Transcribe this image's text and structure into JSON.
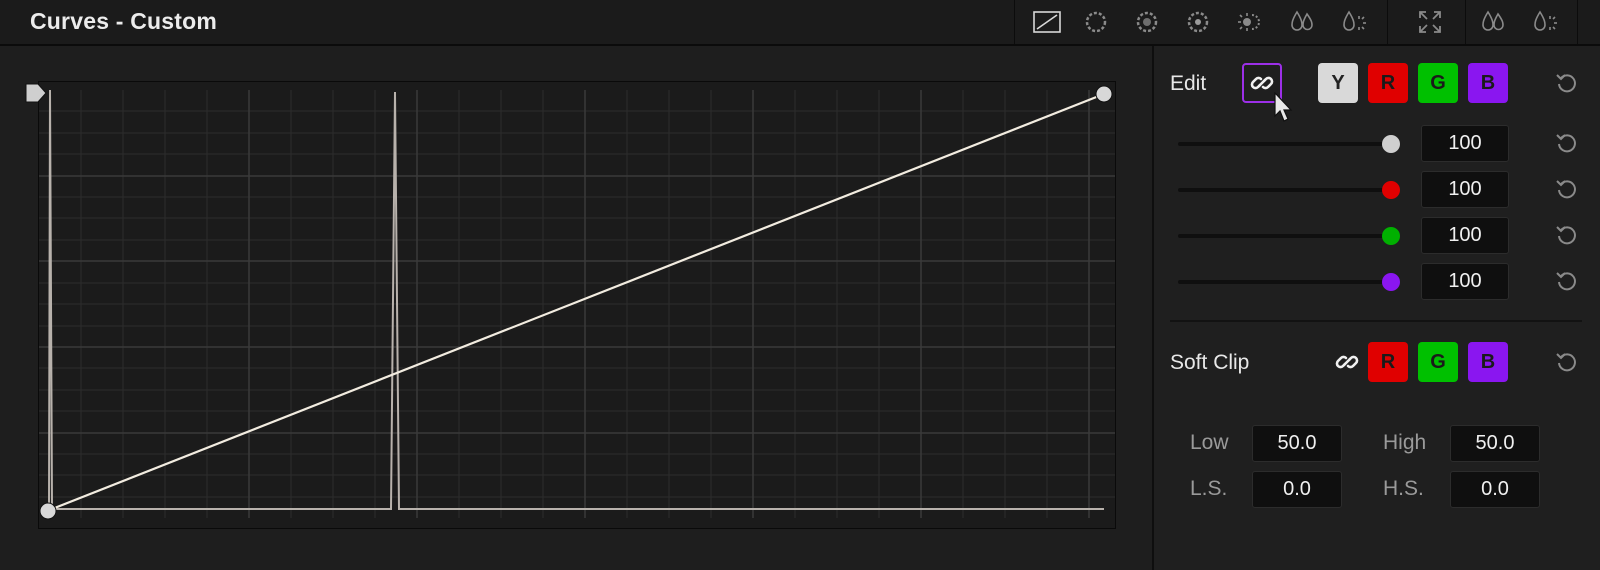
{
  "header": {
    "title": "Curves - Custom"
  },
  "toolbar": {
    "tools": [
      {
        "name": "custom-curve-icon",
        "active": true
      },
      {
        "name": "hue-vs-hue-icon"
      },
      {
        "name": "hue-vs-sat-icon"
      },
      {
        "name": "hue-vs-lum-icon"
      },
      {
        "name": "lum-vs-sat-icon"
      },
      {
        "name": "sat-vs-sat-icon"
      },
      {
        "name": "sat-vs-lum-icon"
      },
      {
        "name": "expand-icon"
      },
      {
        "name": "drop-icon"
      },
      {
        "name": "drop-sun-icon"
      }
    ]
  },
  "edit": {
    "label": "Edit",
    "channels": {
      "y": "Y",
      "r": "R",
      "g": "G",
      "b": "B"
    },
    "sliders": [
      {
        "channel": "Y",
        "value": "100",
        "color": "#cfcfcf"
      },
      {
        "channel": "R",
        "value": "100",
        "color": "#e00000"
      },
      {
        "channel": "G",
        "value": "100",
        "color": "#00b000"
      },
      {
        "channel": "B",
        "value": "100",
        "color": "#8a16f0"
      }
    ]
  },
  "softclip": {
    "label": "Soft Clip",
    "channels": {
      "r": "R",
      "g": "G",
      "b": "B"
    },
    "low_label": "Low",
    "low_value": "50.0",
    "high_label": "High",
    "high_value": "50.0",
    "ls_label": "L.S.",
    "ls_value": "0.0",
    "hs_label": "H.S.",
    "hs_value": "0.0"
  },
  "colors": {
    "accent_purple": "#9c2fe8",
    "curve": "#f2ece0",
    "histogram": "#b8b2ac"
  }
}
